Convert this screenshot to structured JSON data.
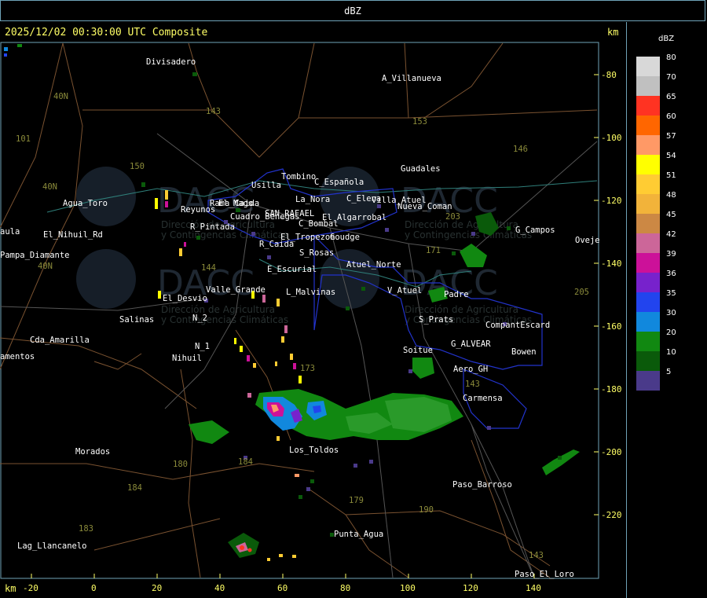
{
  "header": {
    "title": "dBZ"
  },
  "map": {
    "timestamp": "2025/12/02 00:30:00 UTC Composite",
    "unit_top": "km",
    "unit_bottom": "km",
    "y_ticks": [
      "-80",
      "-100",
      "-120",
      "-140",
      "-160",
      "-180",
      "-200",
      "-220"
    ],
    "x_ticks": [
      "-20",
      "0",
      "20",
      "40",
      "60",
      "80",
      "100",
      "120",
      "140"
    ],
    "watermark": [
      "DACC",
      "Dirección de Agricultura",
      "y Contingencias Climáticas"
    ],
    "places": [
      "Divisadero",
      "A_Villanueva",
      "Guadales",
      "Agua_Toro",
      "Usilla",
      "Tombino",
      "C_Española",
      "La_Nora",
      "C_Elena",
      "Rama_Caida",
      "Cuadro_Benegas",
      "SAN_RAFAEL",
      "El_Algarrobal",
      "C_Bombal",
      "Reyunos",
      "El_Nihuil_Rd",
      "El_Tropezon",
      "Goudge",
      "R_Caida",
      "S_Rosas",
      "Atuel_Norte",
      "E_Escurial",
      "Valle_Grande",
      "L_Malvinas",
      "V_Atuel",
      "El_Desvio",
      "Salinas",
      "N_2",
      "N_1",
      "Nihuil",
      "Cda_Amarilla",
      "amentos",
      "Pampa_Diamante",
      "aula",
      "Soitue",
      "G_ALVEAR",
      "Aero_GH",
      "Bowen",
      "CompantEscard",
      "S_Prats",
      "Padre",
      "G_Campos",
      "Oveje",
      "Carmensa",
      "Los_Toldos",
      "Morados",
      "Paso_Barroso",
      "Punta_Agua",
      "Lag_Llancanelo",
      "Paso_El_Loro",
      "Nueva_Coman",
      "Villa_Atuel",
      "R_Pintada",
      "El_Mago"
    ],
    "routes": [
      "143",
      "153",
      "146",
      "150",
      "101",
      "40N",
      "40N",
      "40N",
      "144",
      "171",
      "173",
      "180",
      "184",
      "184",
      "183",
      "179",
      "190",
      "203",
      "205",
      "143",
      "143"
    ]
  },
  "legend": {
    "title": "dBZ",
    "entries": [
      {
        "value": "80",
        "color": "#d8d8d8"
      },
      {
        "value": "70",
        "color": "#c0c0c0"
      },
      {
        "value": "65",
        "color": "#ff3322"
      },
      {
        "value": "60",
        "color": "#ff6600"
      },
      {
        "value": "57",
        "color": "#ff9966"
      },
      {
        "value": "54",
        "color": "#ffff00"
      },
      {
        "value": "51",
        "color": "#ffcc33"
      },
      {
        "value": "48",
        "color": "#f2b33a"
      },
      {
        "value": "45",
        "color": "#cc8844"
      },
      {
        "value": "42",
        "color": "#cc6699"
      },
      {
        "value": "39",
        "color": "#cc1199"
      },
      {
        "value": "36",
        "color": "#7722cc"
      },
      {
        "value": "35",
        "color": "#2244ee"
      },
      {
        "value": "30",
        "color": "#1188dd"
      },
      {
        "value": "20",
        "color": "#118811"
      },
      {
        "value": "10",
        "color": "#0a5a0a"
      },
      {
        "value": "5",
        "color": "#4a3a8a"
      }
    ]
  }
}
